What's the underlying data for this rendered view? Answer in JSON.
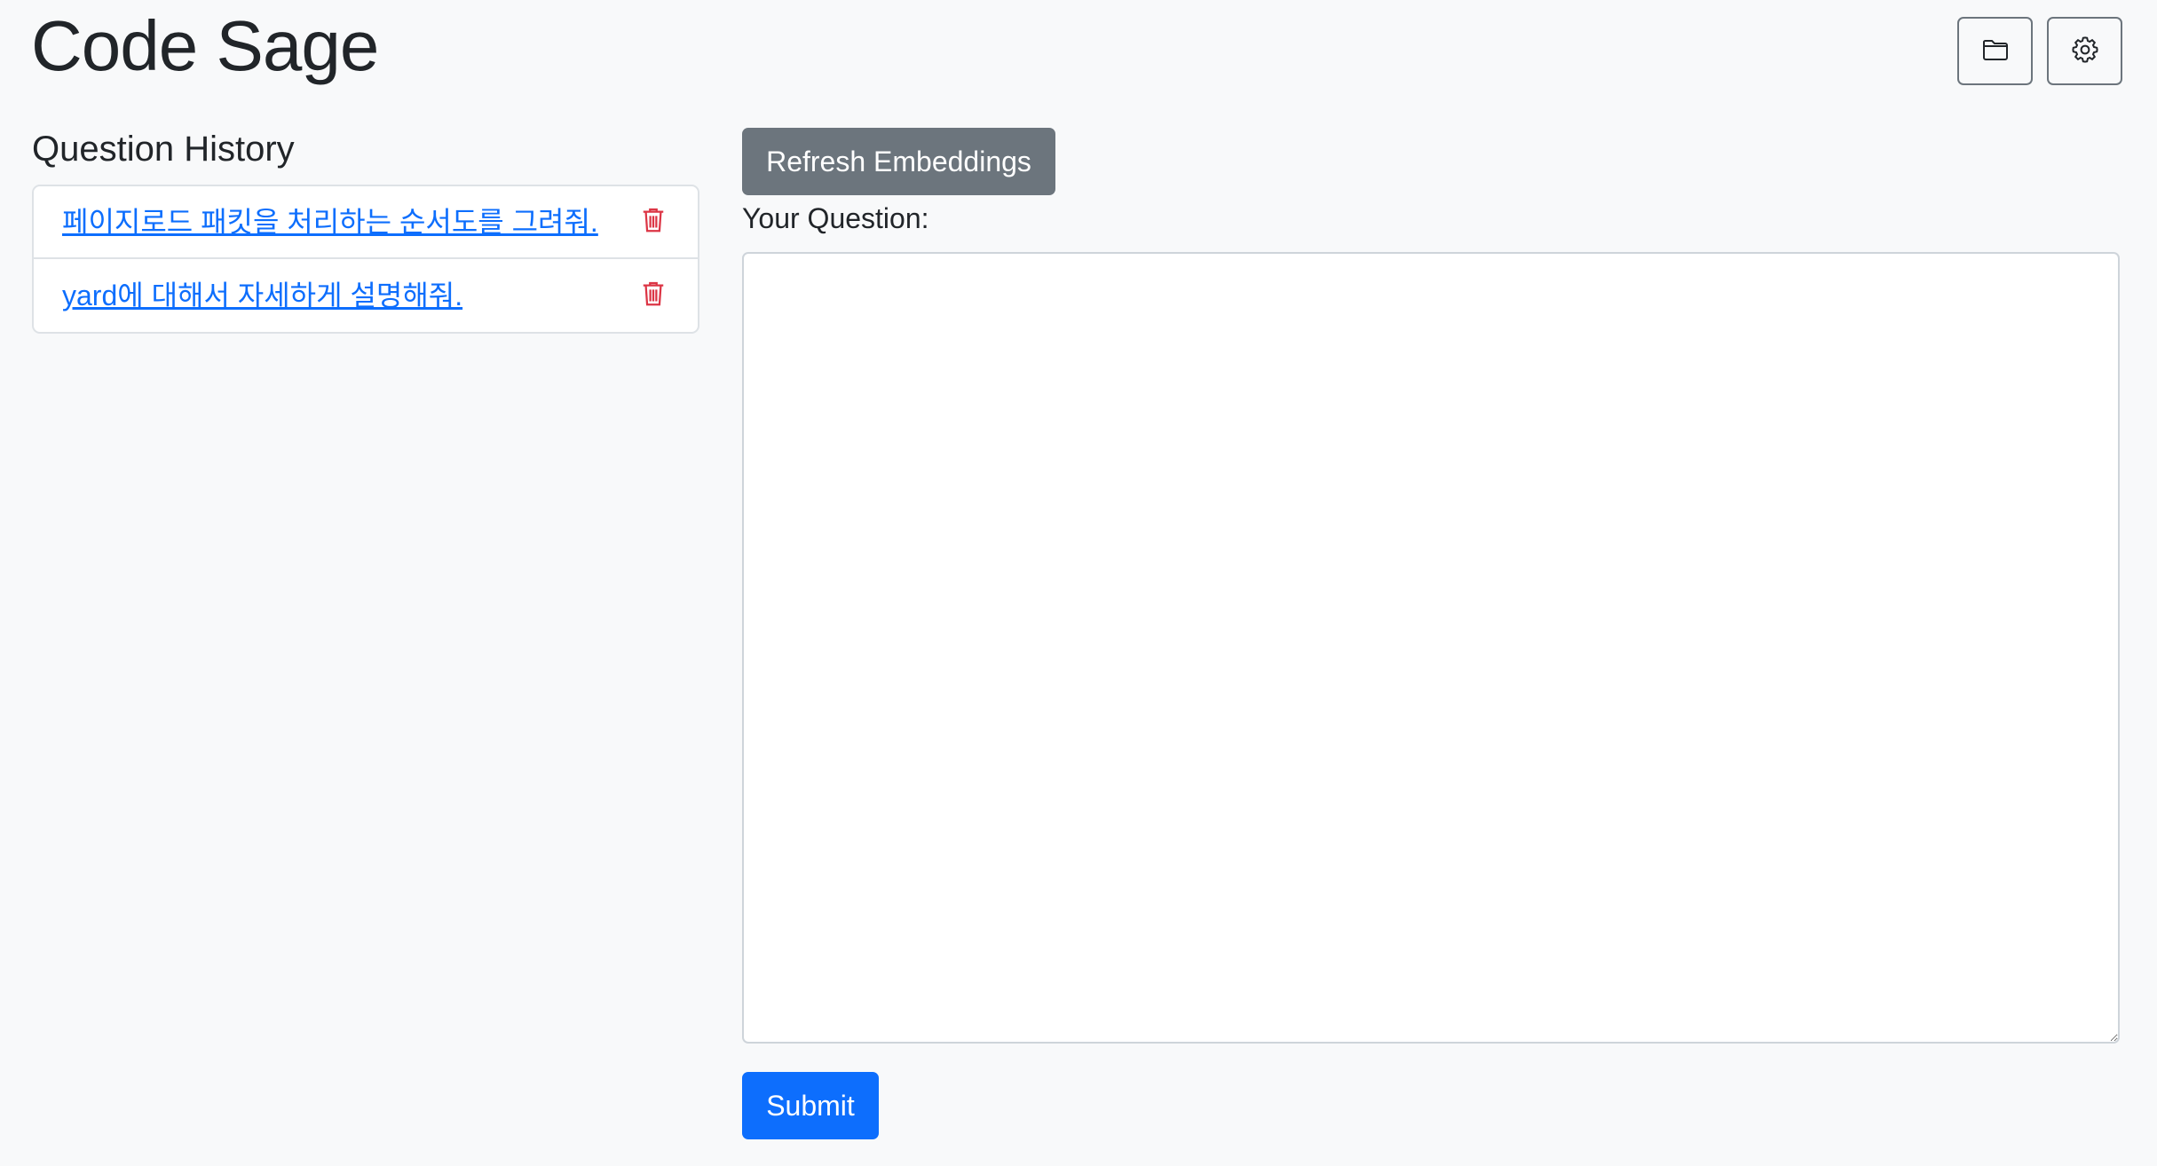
{
  "app": {
    "title": "Code Sage"
  },
  "header": {
    "actions": [
      {
        "icon": "folder-icon"
      },
      {
        "icon": "gear-icon"
      }
    ]
  },
  "history": {
    "title": "Question History",
    "items": [
      {
        "text": "페이지로드 패킷을 처리하는 순서도를 그려줘.",
        "delete_icon": "trash-icon"
      },
      {
        "text": "yard에 대해서 자세하게 설명해줘.",
        "delete_icon": "trash-icon"
      }
    ]
  },
  "main": {
    "refresh_label": "Refresh Embeddings",
    "question_label": "Your Question:",
    "question_value": "",
    "submit_label": "Submit"
  },
  "colors": {
    "background": "#f8f9fa",
    "link": "#0d6efd",
    "danger": "#dc3545",
    "secondary": "#6c757d",
    "primary": "#0d6efd"
  }
}
